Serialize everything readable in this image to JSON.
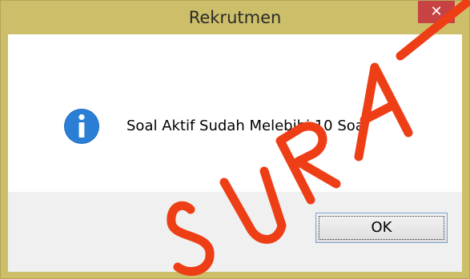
{
  "window": {
    "title": "Rekrutmen",
    "close_glyph": "✕"
  },
  "dialog": {
    "icon": "info-icon",
    "message": "Soal Aktif Sudah Melebihi 10 Soal",
    "ok_label": "OK"
  },
  "watermark": {
    "text": "SURA"
  },
  "colors": {
    "frame": "#cdbf69",
    "close_button": "#c74343",
    "info_icon": "#1e6fc4",
    "watermark": "#ee3e16"
  }
}
